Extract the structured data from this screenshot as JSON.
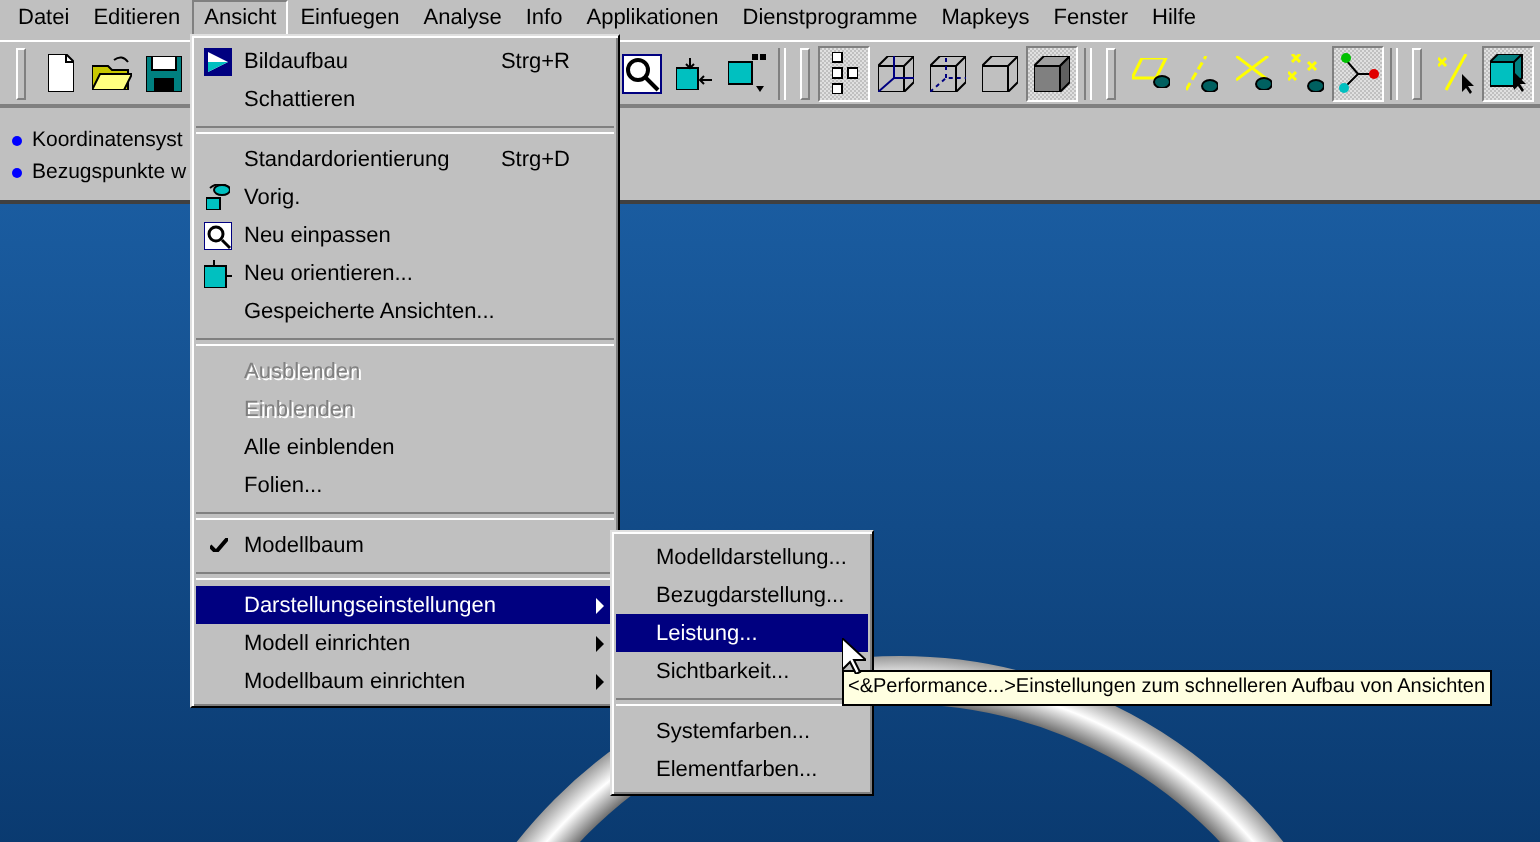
{
  "menubar": [
    {
      "label": "Datei",
      "selected": false
    },
    {
      "label": "Editieren",
      "selected": false
    },
    {
      "label": "Ansicht",
      "selected": true
    },
    {
      "label": "Einfuegen",
      "selected": false
    },
    {
      "label": "Analyse",
      "selected": false
    },
    {
      "label": "Info",
      "selected": false
    },
    {
      "label": "Applikationen",
      "selected": false
    },
    {
      "label": "Dienstprogramme",
      "selected": false
    },
    {
      "label": "Mapkeys",
      "selected": false
    },
    {
      "label": "Fenster",
      "selected": false
    },
    {
      "label": "Hilfe",
      "selected": false
    }
  ],
  "toolbar": [
    {
      "kind": "button",
      "pressed": false
    },
    {
      "kind": "button",
      "pressed": false
    },
    {
      "kind": "button",
      "pressed": false
    },
    {
      "kind": "hidden"
    },
    {
      "kind": "button",
      "pressed": false
    },
    {
      "kind": "button",
      "pressed": false
    },
    {
      "kind": "button",
      "pressed": false
    },
    {
      "kind": "separator"
    },
    {
      "kind": "button",
      "pressed": true
    },
    {
      "kind": "button",
      "pressed": false
    },
    {
      "kind": "button",
      "pressed": false
    },
    {
      "kind": "button",
      "pressed": false
    },
    {
      "kind": "button",
      "pressed": true
    },
    {
      "kind": "separator"
    },
    {
      "kind": "button",
      "pressed": false
    },
    {
      "kind": "button",
      "pressed": false
    },
    {
      "kind": "button",
      "pressed": false
    },
    {
      "kind": "button",
      "pressed": false
    },
    {
      "kind": "button",
      "pressed": true
    },
    {
      "kind": "separator"
    },
    {
      "kind": "button",
      "pressed": false
    },
    {
      "kind": "button",
      "pressed": true
    }
  ],
  "info_panel": [
    "Koordinatensyst",
    "Bezugspunkte w"
  ],
  "menu": [
    {
      "kind": "item",
      "label": "Bildaufbau",
      "shortcut": "Strg+R",
      "disabled": false,
      "checked": false,
      "submenu": false,
      "selected": false
    },
    {
      "kind": "item",
      "label": "Schattieren",
      "disabled": false,
      "checked": false,
      "submenu": false,
      "selected": false
    },
    {
      "kind": "separator"
    },
    {
      "kind": "item",
      "label": "Standardorientierung",
      "shortcut": "Strg+D",
      "disabled": false,
      "checked": false,
      "submenu": false,
      "selected": false
    },
    {
      "kind": "item",
      "label": "Vorig.",
      "disabled": false,
      "checked": false,
      "submenu": false,
      "selected": false
    },
    {
      "kind": "item",
      "label": "Neu einpassen",
      "disabled": false,
      "checked": false,
      "submenu": false,
      "selected": false
    },
    {
      "kind": "item",
      "label": "Neu orientieren...",
      "disabled": false,
      "checked": false,
      "submenu": false,
      "selected": false
    },
    {
      "kind": "item",
      "label": "Gespeicherte Ansichten...",
      "disabled": false,
      "checked": false,
      "submenu": false,
      "selected": false
    },
    {
      "kind": "separator"
    },
    {
      "kind": "item",
      "label": "Ausblenden",
      "disabled": true,
      "checked": false,
      "submenu": false,
      "selected": false
    },
    {
      "kind": "item",
      "label": "Einblenden",
      "disabled": true,
      "checked": false,
      "submenu": false,
      "selected": false
    },
    {
      "kind": "item",
      "label": "Alle einblenden",
      "disabled": false,
      "checked": false,
      "submenu": false,
      "selected": false
    },
    {
      "kind": "item",
      "label": "Folien...",
      "disabled": false,
      "checked": false,
      "submenu": false,
      "selected": false
    },
    {
      "kind": "separator"
    },
    {
      "kind": "item",
      "label": "Modellbaum",
      "disabled": false,
      "checked": true,
      "submenu": false,
      "selected": false
    },
    {
      "kind": "separator"
    },
    {
      "kind": "item",
      "label": "Darstellungseinstellungen",
      "disabled": false,
      "checked": false,
      "submenu": true,
      "selected": true
    },
    {
      "kind": "item",
      "label": "Modell einrichten",
      "disabled": false,
      "checked": false,
      "submenu": true,
      "selected": false
    },
    {
      "kind": "item",
      "label": "Modellbaum einrichten",
      "disabled": false,
      "checked": false,
      "submenu": true,
      "selected": false
    }
  ],
  "submenu": [
    {
      "kind": "item",
      "label": "Modelldarstellung...",
      "selected": false
    },
    {
      "kind": "item",
      "label": "Bezugdarstellung...",
      "selected": false
    },
    {
      "kind": "item",
      "label": "Leistung...",
      "selected": true
    },
    {
      "kind": "item",
      "label": "Sichtbarkeit...",
      "selected": false
    },
    {
      "kind": "separator"
    },
    {
      "kind": "item",
      "label": "Systemfarben...",
      "selected": false
    },
    {
      "kind": "item",
      "label": "Elementfarben...",
      "selected": false
    }
  ],
  "tooltip": "<&Performance...>Einstellungen zum schnelleren Aufbau von Ansichten"
}
